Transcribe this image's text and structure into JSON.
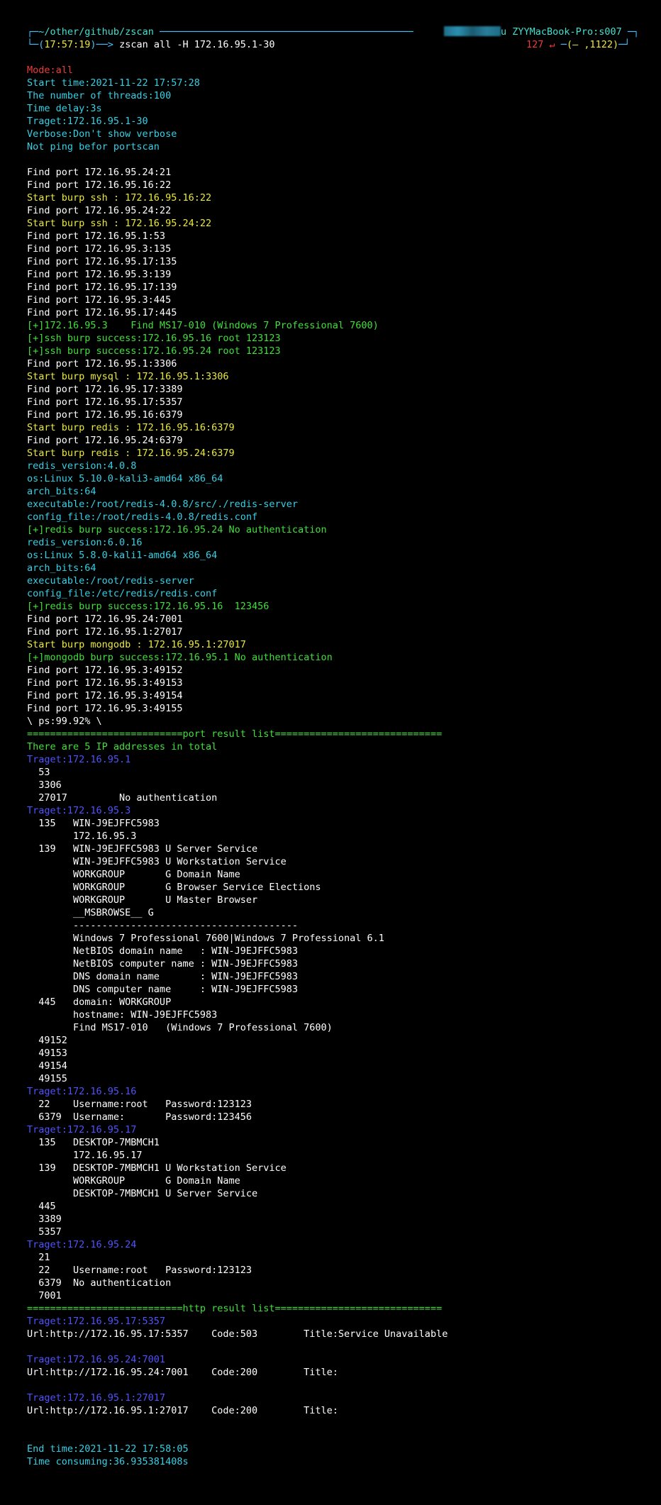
{
  "prompt": {
    "path": "~/other/github/zscan",
    "time": "17:57:19",
    "command": "zscan all -H 172.16.95.1-30",
    "host_prefix": "u",
    "host": "ZYYMacBook-Pro:s007",
    "exit_code": "127",
    "return_icon": "↵",
    "status_right": "(— ,1122)"
  },
  "colors": {
    "background": "#000000",
    "white": "#ffffff",
    "cyan": "#33d1e6",
    "yellow": "#eaea35",
    "green": "#3fe03a",
    "red": "#f03a3a",
    "blue": "#5151ff"
  },
  "lines": [
    {
      "c": "red",
      "t": "Mode:all"
    },
    {
      "c": "cyan",
      "t": "Start time:2021-11-22 17:57:28"
    },
    {
      "c": "cyan",
      "t": "The number of threads:100"
    },
    {
      "c": "cyan",
      "t": "Time delay:3s"
    },
    {
      "c": "cyan",
      "t": "Traget:172.16.95.1-30"
    },
    {
      "c": "cyan",
      "t": "Verbose:Don't show verbose"
    },
    {
      "c": "cyan",
      "t": "Not ping befor portscan"
    },
    {
      "c": "white",
      "t": ""
    },
    {
      "c": "white",
      "t": "Find port 172.16.95.24:21"
    },
    {
      "c": "white",
      "t": "Find port 172.16.95.16:22"
    },
    {
      "c": "yellow",
      "t": "Start burp ssh : 172.16.95.16:22"
    },
    {
      "c": "white",
      "t": "Find port 172.16.95.24:22"
    },
    {
      "c": "yellow",
      "t": "Start burp ssh : 172.16.95.24:22"
    },
    {
      "c": "white",
      "t": "Find port 172.16.95.1:53"
    },
    {
      "c": "white",
      "t": "Find port 172.16.95.3:135"
    },
    {
      "c": "white",
      "t": "Find port 172.16.95.17:135"
    },
    {
      "c": "white",
      "t": "Find port 172.16.95.3:139"
    },
    {
      "c": "white",
      "t": "Find port 172.16.95.17:139"
    },
    {
      "c": "white",
      "t": "Find port 172.16.95.3:445"
    },
    {
      "c": "white",
      "t": "Find port 172.16.95.17:445"
    },
    {
      "c": "green",
      "t": "[+]172.16.95.3    Find MS17-010 (Windows 7 Professional 7600)"
    },
    {
      "c": "green",
      "t": "[+]ssh burp success:172.16.95.16 root 123123"
    },
    {
      "c": "green",
      "t": "[+]ssh burp success:172.16.95.24 root 123123"
    },
    {
      "c": "white",
      "t": "Find port 172.16.95.1:3306"
    },
    {
      "c": "yellow",
      "t": "Start burp mysql : 172.16.95.1:3306"
    },
    {
      "c": "white",
      "t": "Find port 172.16.95.17:3389"
    },
    {
      "c": "white",
      "t": "Find port 172.16.95.17:5357"
    },
    {
      "c": "white",
      "t": "Find port 172.16.95.16:6379"
    },
    {
      "c": "yellow",
      "t": "Start burp redis : 172.16.95.16:6379"
    },
    {
      "c": "white",
      "t": "Find port 172.16.95.24:6379"
    },
    {
      "c": "yellow",
      "t": "Start burp redis : 172.16.95.24:6379"
    },
    {
      "c": "cyan",
      "t": "redis_version:4.0.8"
    },
    {
      "c": "cyan",
      "t": "os:Linux 5.10.0-kali3-amd64 x86_64"
    },
    {
      "c": "cyan",
      "t": "arch_bits:64"
    },
    {
      "c": "cyan",
      "t": "executable:/root/redis-4.0.8/src/./redis-server"
    },
    {
      "c": "cyan",
      "t": "config_file:/root/redis-4.0.8/redis.conf"
    },
    {
      "c": "green",
      "t": "[+]redis burp success:172.16.95.24 No authentication"
    },
    {
      "c": "cyan",
      "t": "redis_version:6.0.16"
    },
    {
      "c": "cyan",
      "t": "os:Linux 5.8.0-kali1-amd64 x86_64"
    },
    {
      "c": "cyan",
      "t": "arch_bits:64"
    },
    {
      "c": "cyan",
      "t": "executable:/root/redis-server"
    },
    {
      "c": "cyan",
      "t": "config_file:/etc/redis/redis.conf"
    },
    {
      "c": "green",
      "t": "[+]redis burp success:172.16.95.16  123456"
    },
    {
      "c": "white",
      "t": "Find port 172.16.95.24:7001"
    },
    {
      "c": "white",
      "t": "Find port 172.16.95.1:27017"
    },
    {
      "c": "yellow",
      "t": "Start burp mongodb : 172.16.95.1:27017"
    },
    {
      "c": "green",
      "t": "[+]mongodb burp success:172.16.95.1 No authentication"
    },
    {
      "c": "white",
      "t": "Find port 172.16.95.3:49152"
    },
    {
      "c": "white",
      "t": "Find port 172.16.95.3:49153"
    },
    {
      "c": "white",
      "t": "Find port 172.16.95.3:49154"
    },
    {
      "c": "white",
      "t": "Find port 172.16.95.3:49155"
    },
    {
      "c": "white",
      "t": "\\ ps:99.92% \\"
    },
    {
      "c": "green",
      "t": "===========================port result list============================="
    },
    {
      "c": "green",
      "t": "There are 5 IP addresses in total"
    },
    {
      "c": "blue",
      "t": "Traget:172.16.95.1"
    },
    {
      "c": "white",
      "t": "  53"
    },
    {
      "c": "white",
      "t": "  3306"
    },
    {
      "c": "white",
      "t": "  27017         No authentication"
    },
    {
      "c": "blue",
      "t": "Traget:172.16.95.3"
    },
    {
      "c": "white",
      "t": "  135   WIN-J9EJFFC5983"
    },
    {
      "c": "white",
      "t": "        172.16.95.3"
    },
    {
      "c": "white",
      "t": "  139   WIN-J9EJFFC5983 U Server Service"
    },
    {
      "c": "white",
      "t": "        WIN-J9EJFFC5983 U Workstation Service"
    },
    {
      "c": "white",
      "t": "        WORKGROUP       G Domain Name"
    },
    {
      "c": "white",
      "t": "        WORKGROUP       G Browser Service Elections"
    },
    {
      "c": "white",
      "t": "        WORKGROUP       U Master Browser"
    },
    {
      "c": "white",
      "t": "        __MSBROWSE__ G"
    },
    {
      "c": "white",
      "t": "        ---------------------------------------"
    },
    {
      "c": "white",
      "t": "        Windows 7 Professional 7600|Windows 7 Professional 6.1"
    },
    {
      "c": "white",
      "t": "        NetBIOS domain name   : WIN-J9EJFFC5983"
    },
    {
      "c": "white",
      "t": "        NetBIOS computer name : WIN-J9EJFFC5983"
    },
    {
      "c": "white",
      "t": "        DNS domain name       : WIN-J9EJFFC5983"
    },
    {
      "c": "white",
      "t": "        DNS computer name     : WIN-J9EJFFC5983"
    },
    {
      "c": "white",
      "t": "  445   domain: WORKGROUP"
    },
    {
      "c": "white",
      "t": "        hostname: WIN-J9EJFFC5983"
    },
    {
      "c": "white",
      "t": "        Find MS17-010   (Windows 7 Professional 7600)"
    },
    {
      "c": "white",
      "t": "  49152"
    },
    {
      "c": "white",
      "t": "  49153"
    },
    {
      "c": "white",
      "t": "  49154"
    },
    {
      "c": "white",
      "t": "  49155"
    },
    {
      "c": "blue",
      "t": "Traget:172.16.95.16"
    },
    {
      "c": "white",
      "t": "  22    Username:root   Password:123123"
    },
    {
      "c": "white",
      "t": "  6379  Username:       Password:123456"
    },
    {
      "c": "blue",
      "t": "Traget:172.16.95.17"
    },
    {
      "c": "white",
      "t": "  135   DESKTOP-7MBMCH1"
    },
    {
      "c": "white",
      "t": "        172.16.95.17"
    },
    {
      "c": "white",
      "t": "  139   DESKTOP-7MBMCH1 U Workstation Service"
    },
    {
      "c": "white",
      "t": "        WORKGROUP       G Domain Name"
    },
    {
      "c": "white",
      "t": "        DESKTOP-7MBMCH1 U Server Service"
    },
    {
      "c": "white",
      "t": "  445"
    },
    {
      "c": "white",
      "t": "  3389"
    },
    {
      "c": "white",
      "t": "  5357"
    },
    {
      "c": "blue",
      "t": "Traget:172.16.95.24"
    },
    {
      "c": "white",
      "t": "  21"
    },
    {
      "c": "white",
      "t": "  22    Username:root   Password:123123"
    },
    {
      "c": "white",
      "t": "  6379  No authentication"
    },
    {
      "c": "white",
      "t": "  7001"
    },
    {
      "c": "green",
      "t": "===========================http result list============================="
    },
    {
      "c": "blue",
      "t": "Traget:172.16.95.17:5357"
    },
    {
      "c": "white",
      "t": "Url:http://172.16.95.17:5357    Code:503        Title:Service Unavailable"
    },
    {
      "c": "white",
      "t": ""
    },
    {
      "c": "blue",
      "t": "Traget:172.16.95.24:7001"
    },
    {
      "c": "white",
      "t": "Url:http://172.16.95.24:7001    Code:200        Title:"
    },
    {
      "c": "white",
      "t": ""
    },
    {
      "c": "blue",
      "t": "Traget:172.16.95.1:27017"
    },
    {
      "c": "white",
      "t": "Url:http://172.16.95.1:27017    Code:200        Title:"
    },
    {
      "c": "white",
      "t": ""
    },
    {
      "c": "white",
      "t": ""
    },
    {
      "c": "cyan",
      "t": "End time:2021-11-22 17:58:05"
    },
    {
      "c": "cyan",
      "t": "Time consuming:36.935381408s"
    }
  ]
}
